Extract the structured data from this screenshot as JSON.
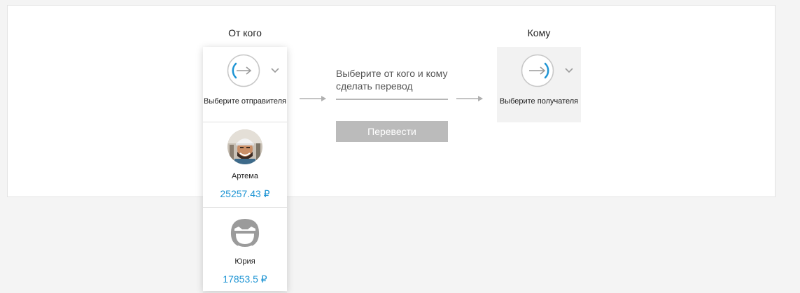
{
  "from": {
    "title": "От кого",
    "placeholder_label": "Выберите отправителя",
    "placeholder_icon": "arrow-circle-icon",
    "accounts": [
      {
        "name": "Артема",
        "amount": "25257.43 ₽",
        "avatar": "photo-avatar"
      },
      {
        "name": "Юрия",
        "amount": "17853.5 ₽",
        "avatar": "default-avatar-icon"
      }
    ]
  },
  "to": {
    "title": "Кому",
    "placeholder_label": "Выберите получателя",
    "placeholder_icon": "arrow-circle-icon"
  },
  "hint": "Выберите от кого и кому сделать перевод",
  "transfer_button": "Перевести",
  "colors": {
    "accent": "#1f95d4",
    "button_disabled": "#bbbbbb",
    "background": "#f4f4f4"
  }
}
